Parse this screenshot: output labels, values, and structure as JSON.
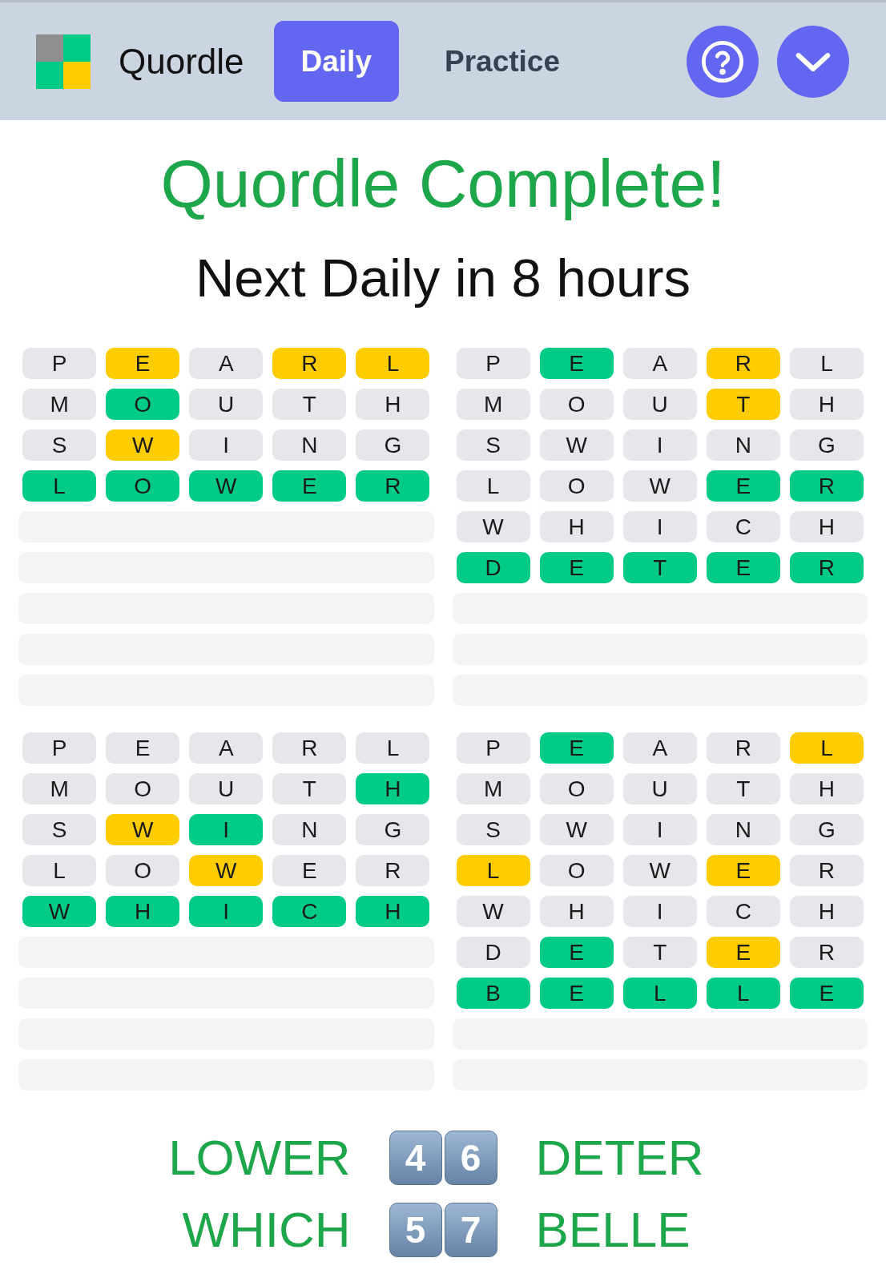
{
  "header": {
    "title": "Quordle",
    "tabs": [
      {
        "label": "Daily",
        "selected": true
      },
      {
        "label": "Practice",
        "selected": false
      }
    ]
  },
  "status": {
    "headline": "Quordle Complete!",
    "subline": "Next Daily in 8 hours"
  },
  "boards": [
    {
      "rows": [
        {
          "kind": "guess",
          "tiles": [
            {
              "letter": "P",
              "color": "#e5e7eb"
            },
            {
              "letter": "E",
              "color": "#ffcc00"
            },
            {
              "letter": "A",
              "color": "#e5e7eb"
            },
            {
              "letter": "R",
              "color": "#ffcc00"
            },
            {
              "letter": "L",
              "color": "#ffcc00"
            }
          ]
        },
        {
          "kind": "guess",
          "tiles": [
            {
              "letter": "M",
              "color": "#e5e7eb"
            },
            {
              "letter": "O",
              "color": "#00cc88"
            },
            {
              "letter": "U",
              "color": "#e5e7eb"
            },
            {
              "letter": "T",
              "color": "#e5e7eb"
            },
            {
              "letter": "H",
              "color": "#e5e7eb"
            }
          ]
        },
        {
          "kind": "guess",
          "tiles": [
            {
              "letter": "S",
              "color": "#e5e7eb"
            },
            {
              "letter": "W",
              "color": "#ffcc00"
            },
            {
              "letter": "I",
              "color": "#e5e7eb"
            },
            {
              "letter": "N",
              "color": "#e5e7eb"
            },
            {
              "letter": "G",
              "color": "#e5e7eb"
            }
          ]
        },
        {
          "kind": "guess",
          "tiles": [
            {
              "letter": "L",
              "color": "#00cc88"
            },
            {
              "letter": "O",
              "color": "#00cc88"
            },
            {
              "letter": "W",
              "color": "#00cc88"
            },
            {
              "letter": "E",
              "color": "#00cc88"
            },
            {
              "letter": "R",
              "color": "#00cc88"
            }
          ]
        },
        {
          "kind": "empty"
        },
        {
          "kind": "empty"
        },
        {
          "kind": "empty"
        },
        {
          "kind": "empty"
        },
        {
          "kind": "empty"
        }
      ]
    },
    {
      "rows": [
        {
          "kind": "guess",
          "tiles": [
            {
              "letter": "P",
              "color": "#e5e7eb"
            },
            {
              "letter": "E",
              "color": "#00cc88"
            },
            {
              "letter": "A",
              "color": "#e5e7eb"
            },
            {
              "letter": "R",
              "color": "#ffcc00"
            },
            {
              "letter": "L",
              "color": "#e5e7eb"
            }
          ]
        },
        {
          "kind": "guess",
          "tiles": [
            {
              "letter": "M",
              "color": "#e5e7eb"
            },
            {
              "letter": "O",
              "color": "#e5e7eb"
            },
            {
              "letter": "U",
              "color": "#e5e7eb"
            },
            {
              "letter": "T",
              "color": "#ffcc00"
            },
            {
              "letter": "H",
              "color": "#e5e7eb"
            }
          ]
        },
        {
          "kind": "guess",
          "tiles": [
            {
              "letter": "S",
              "color": "#e5e7eb"
            },
            {
              "letter": "W",
              "color": "#e5e7eb"
            },
            {
              "letter": "I",
              "color": "#e5e7eb"
            },
            {
              "letter": "N",
              "color": "#e5e7eb"
            },
            {
              "letter": "G",
              "color": "#e5e7eb"
            }
          ]
        },
        {
          "kind": "guess",
          "tiles": [
            {
              "letter": "L",
              "color": "#e5e7eb"
            },
            {
              "letter": "O",
              "color": "#e5e7eb"
            },
            {
              "letter": "W",
              "color": "#e5e7eb"
            },
            {
              "letter": "E",
              "color": "#00cc88"
            },
            {
              "letter": "R",
              "color": "#00cc88"
            }
          ]
        },
        {
          "kind": "guess",
          "tiles": [
            {
              "letter": "W",
              "color": "#e5e7eb"
            },
            {
              "letter": "H",
              "color": "#e5e7eb"
            },
            {
              "letter": "I",
              "color": "#e5e7eb"
            },
            {
              "letter": "C",
              "color": "#e5e7eb"
            },
            {
              "letter": "H",
              "color": "#e5e7eb"
            }
          ]
        },
        {
          "kind": "guess",
          "tiles": [
            {
              "letter": "D",
              "color": "#00cc88"
            },
            {
              "letter": "E",
              "color": "#00cc88"
            },
            {
              "letter": "T",
              "color": "#00cc88"
            },
            {
              "letter": "E",
              "color": "#00cc88"
            },
            {
              "letter": "R",
              "color": "#00cc88"
            }
          ]
        },
        {
          "kind": "empty"
        },
        {
          "kind": "empty"
        },
        {
          "kind": "empty"
        }
      ]
    },
    {
      "rows": [
        {
          "kind": "guess",
          "tiles": [
            {
              "letter": "P",
              "color": "#e5e7eb"
            },
            {
              "letter": "E",
              "color": "#e5e7eb"
            },
            {
              "letter": "A",
              "color": "#e5e7eb"
            },
            {
              "letter": "R",
              "color": "#e5e7eb"
            },
            {
              "letter": "L",
              "color": "#e5e7eb"
            }
          ]
        },
        {
          "kind": "guess",
          "tiles": [
            {
              "letter": "M",
              "color": "#e5e7eb"
            },
            {
              "letter": "O",
              "color": "#e5e7eb"
            },
            {
              "letter": "U",
              "color": "#e5e7eb"
            },
            {
              "letter": "T",
              "color": "#e5e7eb"
            },
            {
              "letter": "H",
              "color": "#00cc88"
            }
          ]
        },
        {
          "kind": "guess",
          "tiles": [
            {
              "letter": "S",
              "color": "#e5e7eb"
            },
            {
              "letter": "W",
              "color": "#ffcc00"
            },
            {
              "letter": "I",
              "color": "#00cc88"
            },
            {
              "letter": "N",
              "color": "#e5e7eb"
            },
            {
              "letter": "G",
              "color": "#e5e7eb"
            }
          ]
        },
        {
          "kind": "guess",
          "tiles": [
            {
              "letter": "L",
              "color": "#e5e7eb"
            },
            {
              "letter": "O",
              "color": "#e5e7eb"
            },
            {
              "letter": "W",
              "color": "#ffcc00"
            },
            {
              "letter": "E",
              "color": "#e5e7eb"
            },
            {
              "letter": "R",
              "color": "#e5e7eb"
            }
          ]
        },
        {
          "kind": "guess",
          "tiles": [
            {
              "letter": "W",
              "color": "#00cc88"
            },
            {
              "letter": "H",
              "color": "#00cc88"
            },
            {
              "letter": "I",
              "color": "#00cc88"
            },
            {
              "letter": "C",
              "color": "#00cc88"
            },
            {
              "letter": "H",
              "color": "#00cc88"
            }
          ]
        },
        {
          "kind": "empty"
        },
        {
          "kind": "empty"
        },
        {
          "kind": "empty"
        },
        {
          "kind": "empty"
        }
      ]
    },
    {
      "rows": [
        {
          "kind": "guess",
          "tiles": [
            {
              "letter": "P",
              "color": "#e5e7eb"
            },
            {
              "letter": "E",
              "color": "#00cc88"
            },
            {
              "letter": "A",
              "color": "#e5e7eb"
            },
            {
              "letter": "R",
              "color": "#e5e7eb"
            },
            {
              "letter": "L",
              "color": "#ffcc00"
            }
          ]
        },
        {
          "kind": "guess",
          "tiles": [
            {
              "letter": "M",
              "color": "#e5e7eb"
            },
            {
              "letter": "O",
              "color": "#e5e7eb"
            },
            {
              "letter": "U",
              "color": "#e5e7eb"
            },
            {
              "letter": "T",
              "color": "#e5e7eb"
            },
            {
              "letter": "H",
              "color": "#e5e7eb"
            }
          ]
        },
        {
          "kind": "guess",
          "tiles": [
            {
              "letter": "S",
              "color": "#e5e7eb"
            },
            {
              "letter": "W",
              "color": "#e5e7eb"
            },
            {
              "letter": "I",
              "color": "#e5e7eb"
            },
            {
              "letter": "N",
              "color": "#e5e7eb"
            },
            {
              "letter": "G",
              "color": "#e5e7eb"
            }
          ]
        },
        {
          "kind": "guess",
          "tiles": [
            {
              "letter": "L",
              "color": "#ffcc00"
            },
            {
              "letter": "O",
              "color": "#e5e7eb"
            },
            {
              "letter": "W",
              "color": "#e5e7eb"
            },
            {
              "letter": "E",
              "color": "#ffcc00"
            },
            {
              "letter": "R",
              "color": "#e5e7eb"
            }
          ]
        },
        {
          "kind": "guess",
          "tiles": [
            {
              "letter": "W",
              "color": "#e5e7eb"
            },
            {
              "letter": "H",
              "color": "#e5e7eb"
            },
            {
              "letter": "I",
              "color": "#e5e7eb"
            },
            {
              "letter": "C",
              "color": "#e5e7eb"
            },
            {
              "letter": "H",
              "color": "#e5e7eb"
            }
          ]
        },
        {
          "kind": "guess",
          "tiles": [
            {
              "letter": "D",
              "color": "#e5e7eb"
            },
            {
              "letter": "E",
              "color": "#00cc88"
            },
            {
              "letter": "T",
              "color": "#e5e7eb"
            },
            {
              "letter": "E",
              "color": "#ffcc00"
            },
            {
              "letter": "R",
              "color": "#e5e7eb"
            }
          ]
        },
        {
          "kind": "guess",
          "tiles": [
            {
              "letter": "B",
              "color": "#00cc88"
            },
            {
              "letter": "E",
              "color": "#00cc88"
            },
            {
              "letter": "L",
              "color": "#00cc88"
            },
            {
              "letter": "L",
              "color": "#00cc88"
            },
            {
              "letter": "E",
              "color": "#00cc88"
            }
          ]
        },
        {
          "kind": "empty"
        },
        {
          "kind": "empty"
        }
      ]
    }
  ],
  "summary": [
    {
      "left_word": "LOWER",
      "counts": [
        "4",
        "6"
      ],
      "right_word": "DETER"
    },
    {
      "left_word": "WHICH",
      "counts": [
        "5",
        "7"
      ],
      "right_word": "BELLE"
    }
  ]
}
